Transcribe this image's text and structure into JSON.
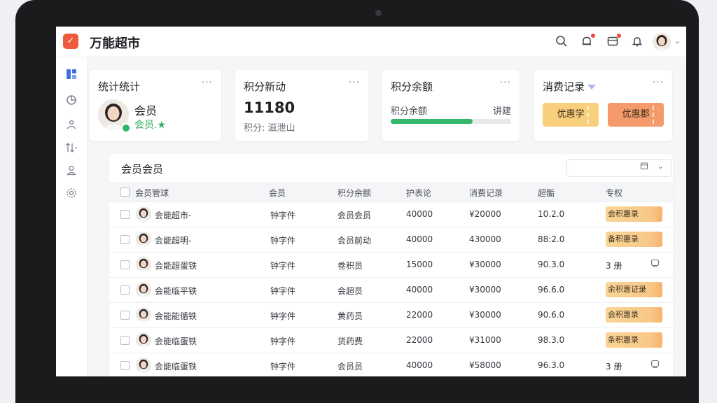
{
  "app": {
    "title": "万能超市",
    "logo_glyph": "✓"
  },
  "topbar": {
    "icons": [
      "search-icon",
      "notification-icon",
      "inbox-icon",
      "bell-icon"
    ],
    "chevron": "⌄"
  },
  "sidebar": {
    "items": [
      "dashboard-icon",
      "analytics-icon",
      "members-icon",
      "sort-icon",
      "user-icon",
      "settings-icon"
    ]
  },
  "cards": {
    "stats": {
      "title": "统计统计",
      "more": "···",
      "name": "会员",
      "sub": "会员.★"
    },
    "points": {
      "title": "积分新动",
      "more": "···",
      "value": "11180",
      "sub": "积分: 滋泄山"
    },
    "balance": {
      "title": "积分余额",
      "more": "···",
      "label": "积分余额",
      "right": "讲建",
      "progress": 0.68
    },
    "spending": {
      "title": "消费记录",
      "more": "···",
      "coupons": [
        "优惠学",
        "优惠郡"
      ]
    }
  },
  "members": {
    "title": "会员会员",
    "headers": [
      "会员管球",
      "会员",
      "积分余额",
      "护表论",
      "消费记录",
      "超骺",
      "专权"
    ],
    "rows": [
      {
        "name": "会能超市-",
        "level": "钟字件",
        "points": "会员会员",
        "a": "40000",
        "spend": "¥20000",
        "b": "10.2.0",
        "tag": "会积惠录",
        "tag_style": "tag"
      },
      {
        "name": "会能超明-",
        "level": "钟字件",
        "points": "会员前动",
        "a": "40000",
        "spend": "430000",
        "b": "88:2.0",
        "tag": "备积惠录",
        "tag_style": "tag"
      },
      {
        "name": "会能超蛋铁",
        "level": "钟字件",
        "points": "卷积员",
        "a": "15000",
        "spend": "¥30000",
        "b": "90.3.0",
        "tag": "3 册",
        "tag_style": "plain"
      },
      {
        "name": "会能临平铁",
        "level": "钟字件",
        "points": "会超员",
        "a": "40000",
        "spend": "¥30000",
        "b": "96.6.0",
        "tag": "余积惠证录",
        "tag_style": "tag"
      },
      {
        "name": "会能能循铁",
        "level": "钟字件",
        "points": "黄药员",
        "a": "22000",
        "spend": "¥30000",
        "b": "90.6.0",
        "tag": "会积惠录",
        "tag_style": "tag"
      },
      {
        "name": "会能临蛋铁",
        "level": "钟字件",
        "points": "货药费",
        "a": "22000",
        "spend": "¥31000",
        "b": "98.3.0",
        "tag": "条积惠录",
        "tag_style": "tag"
      },
      {
        "name": "会能临蛋铁",
        "level": "钟字件",
        "points": "会员员",
        "a": "40000",
        "spend": "¥58000",
        "b": "96.3.0",
        "tag": "3 册",
        "tag_style": "plain"
      }
    ]
  },
  "colors": {
    "accent": "#3d6fe0",
    "logo": "#ef5a3c",
    "success": "#2fb765",
    "progress": "#34b76a",
    "coupon_yellow": "#f7cf7d",
    "coupon_orange": "#f59a6b"
  }
}
